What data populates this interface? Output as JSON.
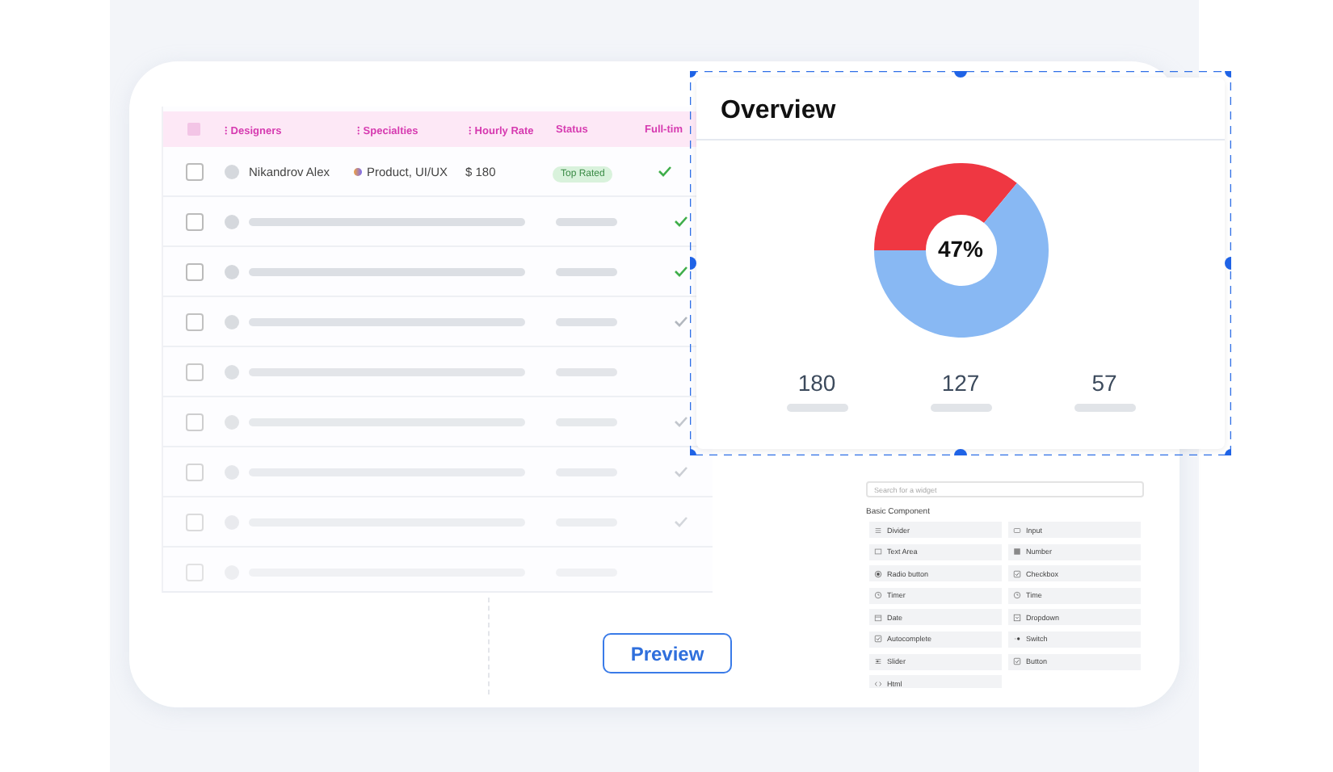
{
  "table": {
    "columns": [
      {
        "label": "⁝ Designers"
      },
      {
        "label": "⁝ Specialties"
      },
      {
        "label": "⁝ Hourly Rate"
      },
      {
        "label": "Status"
      },
      {
        "label": "Full-tim"
      }
    ],
    "header_checked": false,
    "rows": [
      {
        "kind": "data",
        "checked": false,
        "name": "Nikandrov Alex",
        "specialty": "Product, UI/UX",
        "rate": "$ 180",
        "status": "Top Rated",
        "full_time": true
      },
      {
        "kind": "skeleton",
        "checked": false,
        "full_time": true
      },
      {
        "kind": "skeleton",
        "checked": false,
        "full_time": true
      },
      {
        "kind": "skeleton",
        "checked": false,
        "full_time": true
      },
      {
        "kind": "skeleton",
        "checked": false,
        "full_time": false
      },
      {
        "kind": "skeleton",
        "checked": false,
        "full_time": true
      },
      {
        "kind": "skeleton",
        "checked": false,
        "full_time": true
      },
      {
        "kind": "skeleton",
        "checked": false,
        "full_time": true
      },
      {
        "kind": "skeleton",
        "checked": false,
        "full_time": false
      }
    ]
  },
  "overview": {
    "title": "Overview",
    "center_label": "47%",
    "stats": [
      "180",
      "127",
      "57"
    ]
  },
  "widgets": {
    "search": {
      "placeholder": "Search for a widget"
    },
    "section": "Basic Component",
    "items": [
      {
        "label": "Divider",
        "kind": "divider"
      },
      {
        "label": "Input",
        "kind": "input"
      },
      {
        "label": "Text Area",
        "kind": "textarea"
      },
      {
        "label": "Number",
        "kind": "number"
      },
      {
        "label": "Radio button",
        "kind": "radio"
      },
      {
        "label": "Checkbox",
        "kind": "checkbox"
      },
      {
        "label": "Timer",
        "kind": "clock"
      },
      {
        "label": "Time",
        "kind": "clock"
      },
      {
        "label": "Date",
        "kind": "calendar"
      },
      {
        "label": "Dropdown",
        "kind": "dropdown"
      },
      {
        "label": "Autocomplete",
        "kind": "checkbox"
      },
      {
        "label": "Switch",
        "kind": "switch"
      },
      {
        "label": "Slider",
        "kind": "slider"
      },
      {
        "label": "Button",
        "kind": "checkbox"
      },
      {
        "label": "Html",
        "kind": "code"
      }
    ]
  },
  "preview_button": "Preview"
}
